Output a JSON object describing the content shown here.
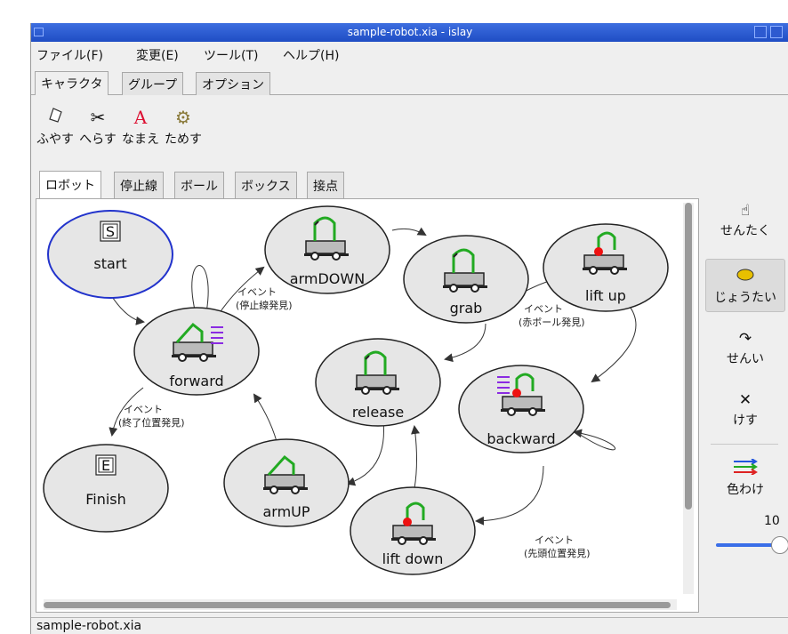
{
  "window": {
    "title": "sample-robot.xia - islay"
  },
  "menubar": [
    "ファイル(F)",
    "変更(E)",
    "ツール(T)",
    "ヘルプ(H)"
  ],
  "main_tabs": [
    "キャラクタ",
    "グループ",
    "オプション"
  ],
  "toolbar": [
    {
      "label": "ふやす",
      "icon": "new-shape-icon"
    },
    {
      "label": "へらす",
      "icon": "scissors-icon"
    },
    {
      "label": "なまえ",
      "icon": "rename-letter-icon"
    },
    {
      "label": "ためす",
      "icon": "gears-icon"
    }
  ],
  "toolbar_name_glyph": "A",
  "inner_tabs": [
    "ロボット",
    "停止線",
    "ボール",
    "ボックス",
    "接点"
  ],
  "nodes": {
    "start": {
      "label": "start",
      "badge": "S"
    },
    "finish": {
      "label": "Finish",
      "badge": "E"
    },
    "forward": "forward",
    "armDOWN": "armDOWN",
    "grab": "grab",
    "liftup": "lift up",
    "release": "release",
    "backward": "backward",
    "armUP": "armUP",
    "liftdown": "lift down"
  },
  "events": {
    "e1": [
      "イベント",
      "(停止線発見)"
    ],
    "e2": [
      "イベント",
      "(赤ボール発見)"
    ],
    "e3": [
      "イベント",
      "(終了位置発見)"
    ],
    "e4": [
      "イベント",
      "(先頭位置発見)"
    ]
  },
  "right_panel": {
    "select": "せんたく",
    "state": "じょうたい",
    "transition": "せんい",
    "delete": "けす",
    "color": "色わけ",
    "slider_value": "10",
    "slider_level": 1.0
  },
  "statusbar": "sample-robot.xia",
  "colors": {
    "titlebar": "#2a5bd7",
    "node_fill": "#e6e6e6",
    "start_border": "#2233cc",
    "robot_arm": "#22aa22",
    "ball": "#ee1111",
    "stripe": "#8a2be2"
  }
}
